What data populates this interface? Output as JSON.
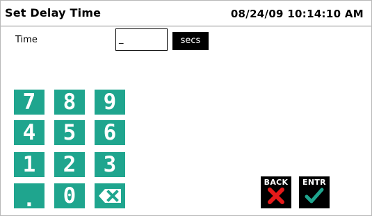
{
  "header": {
    "title": "Set Delay Time",
    "datetime": "08/24/09 10:14:10 AM"
  },
  "form": {
    "field_label": "Time",
    "input_value": "_",
    "units_label": "secs"
  },
  "keypad": {
    "keys": [
      "7",
      "8",
      "9",
      "4",
      "5",
      "6",
      "1",
      "2",
      "3",
      ".",
      "0"
    ],
    "backspace_icon": "backspace-icon"
  },
  "actions": {
    "back_label": "BACK",
    "back_icon": "x-mark-icon",
    "enter_label": "ENTR",
    "enter_icon": "check-mark-icon"
  },
  "colors": {
    "keypad": "#1fa58e",
    "back_x": "#e51a1a",
    "enter_check": "#1fa58e"
  }
}
